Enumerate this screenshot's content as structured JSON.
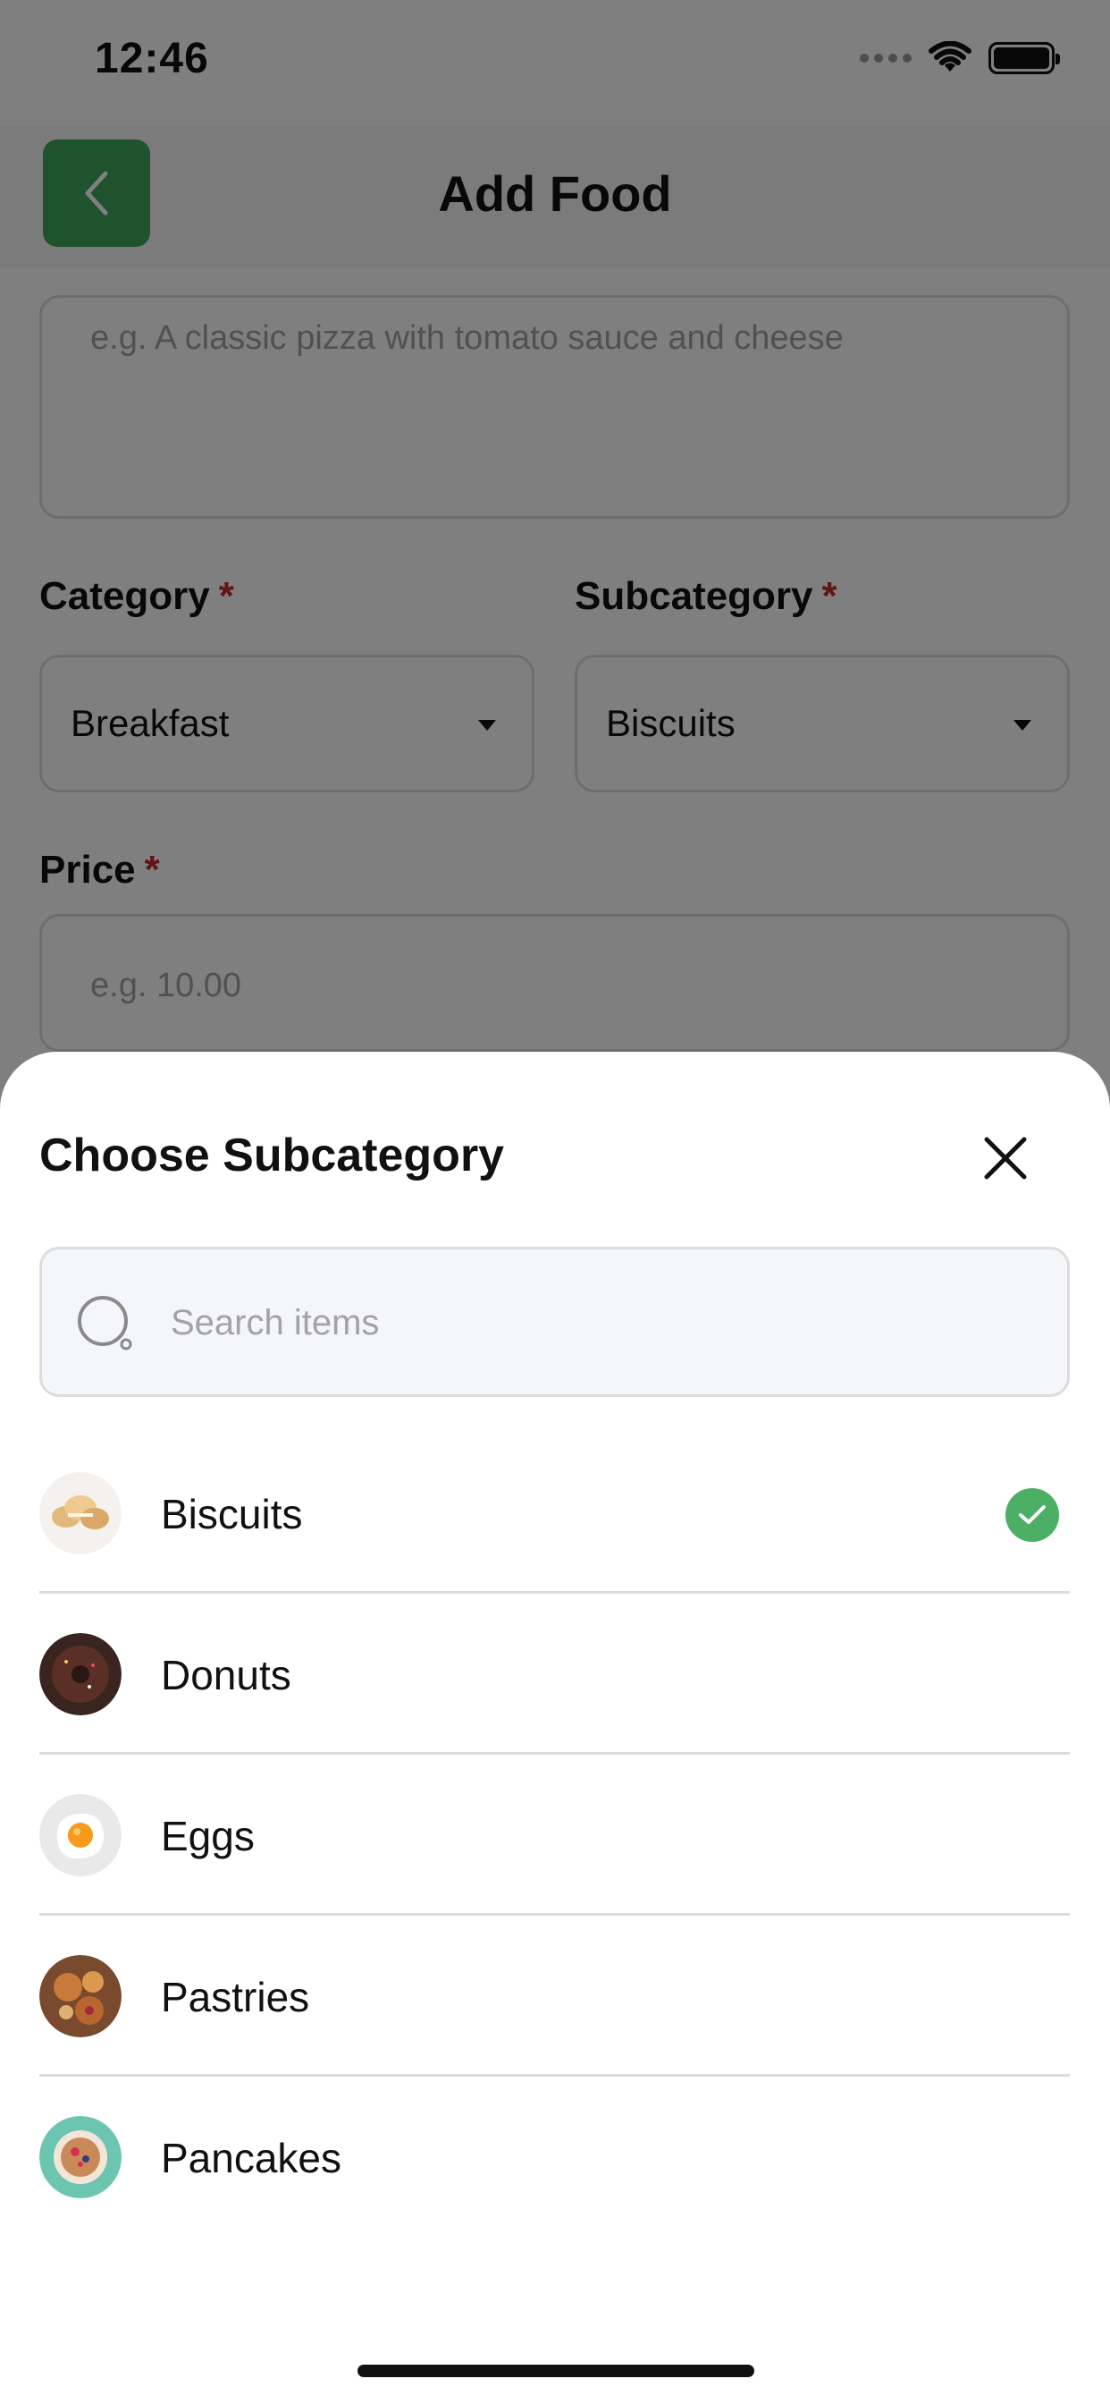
{
  "status_bar": {
    "time": "12:46"
  },
  "nav": {
    "title": "Add Food",
    "back_color": "#3fa65a"
  },
  "form": {
    "description": {
      "placeholder": "e.g. A classic pizza with tomato sauce and cheese"
    },
    "category": {
      "label": "Category",
      "required_mark": "*",
      "value": "Breakfast"
    },
    "subcategory": {
      "label": "Subcategory",
      "required_mark": "*",
      "value": "Biscuits"
    },
    "price": {
      "label": "Price",
      "required_mark": "*",
      "placeholder": "e.g. 10.00"
    }
  },
  "sheet": {
    "title": "Choose Subcategory",
    "search_placeholder": "Search items",
    "items": [
      {
        "label": "Biscuits",
        "icon": "biscuits-thumbnail",
        "selected": true
      },
      {
        "label": "Donuts",
        "icon": "donuts-thumbnail",
        "selected": false
      },
      {
        "label": "Eggs",
        "icon": "eggs-thumbnail",
        "selected": false
      },
      {
        "label": "Pastries",
        "icon": "pastries-thumbnail",
        "selected": false
      },
      {
        "label": "Pancakes",
        "icon": "pancakes-thumbnail",
        "selected": false
      }
    ],
    "selected_color": "#4caf65"
  }
}
